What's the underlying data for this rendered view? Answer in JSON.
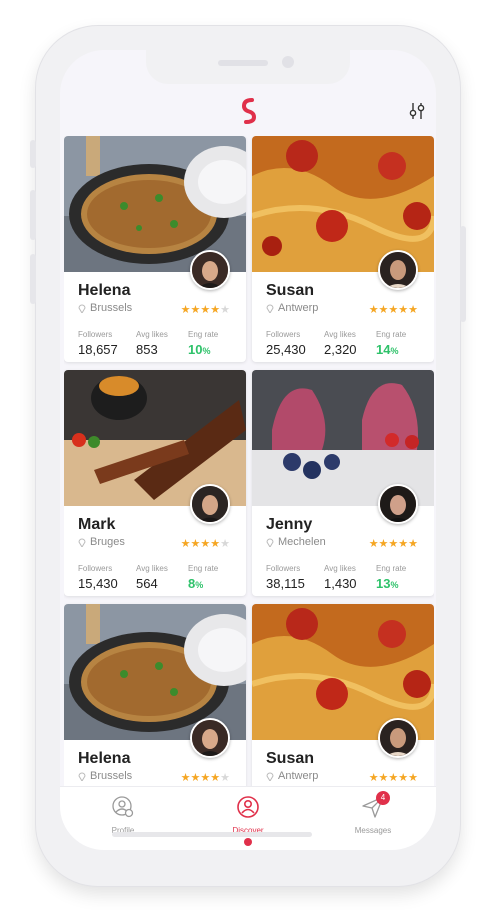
{
  "colors": {
    "accent": "#e0304a",
    "star": "#f5a623",
    "green": "#2ec26a"
  },
  "header": {
    "logo_icon": "brand-s-logo-icon",
    "filter_icon": "sliders-filter-icon"
  },
  "labels": {
    "followers": "Followers",
    "avg_likes": "Avg likes",
    "eng_rate": "Eng rate"
  },
  "cards": [
    {
      "name": "Helena",
      "location": "Brussels",
      "rating": 4,
      "followers": "18,657",
      "avg_likes": "853",
      "eng_rate": "10",
      "image": "pasta-pan",
      "percent": "%"
    },
    {
      "name": "Susan",
      "location": "Antwerp",
      "rating": 5,
      "followers": "25,430",
      "avg_likes": "2,320",
      "eng_rate": "14",
      "image": "spaghetti-tomato",
      "percent": "%"
    },
    {
      "name": "Mark",
      "location": "Bruges",
      "rating": 4,
      "followers": "15,430",
      "avg_likes": "564",
      "eng_rate": "8",
      "image": "bbq-ribs",
      "percent": "%"
    },
    {
      "name": "Jenny",
      "location": "Mechelen",
      "rating": 5,
      "followers": "38,115",
      "avg_likes": "1,430",
      "eng_rate": "13",
      "image": "acai-bowls",
      "percent": "%"
    },
    {
      "name": "Helena",
      "location": "Brussels",
      "rating": 4,
      "image": "pasta-pan"
    },
    {
      "name": "Susan",
      "location": "Antwerp",
      "rating": 5,
      "image": "spaghetti-tomato"
    }
  ],
  "tabbar": {
    "profile": {
      "label": "Profile",
      "icon": "profile-gear-icon"
    },
    "discover": {
      "label": "Discover",
      "icon": "discover-person-icon"
    },
    "messages": {
      "label": "Messages",
      "icon": "paper-plane-icon",
      "badge": "4"
    }
  }
}
